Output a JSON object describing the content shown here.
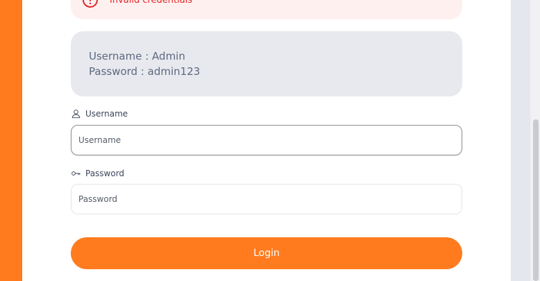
{
  "alert": {
    "message": "Invalid credentials",
    "color": "#e02424",
    "icon": "alert-circle-icon"
  },
  "credentials": {
    "line1": "Username : Admin",
    "line2": "Password : admin123"
  },
  "form": {
    "username": {
      "label": "Username",
      "placeholder": "Username",
      "value": "",
      "icon": "user-icon"
    },
    "password": {
      "label": "Password",
      "placeholder": "Password",
      "value": "",
      "icon": "key-icon"
    },
    "submit_label": "Login"
  },
  "colors": {
    "accent": "#ff7b1d",
    "cred_box_bg": "#e8e9ee",
    "alert_bg": "#fff0f0"
  }
}
